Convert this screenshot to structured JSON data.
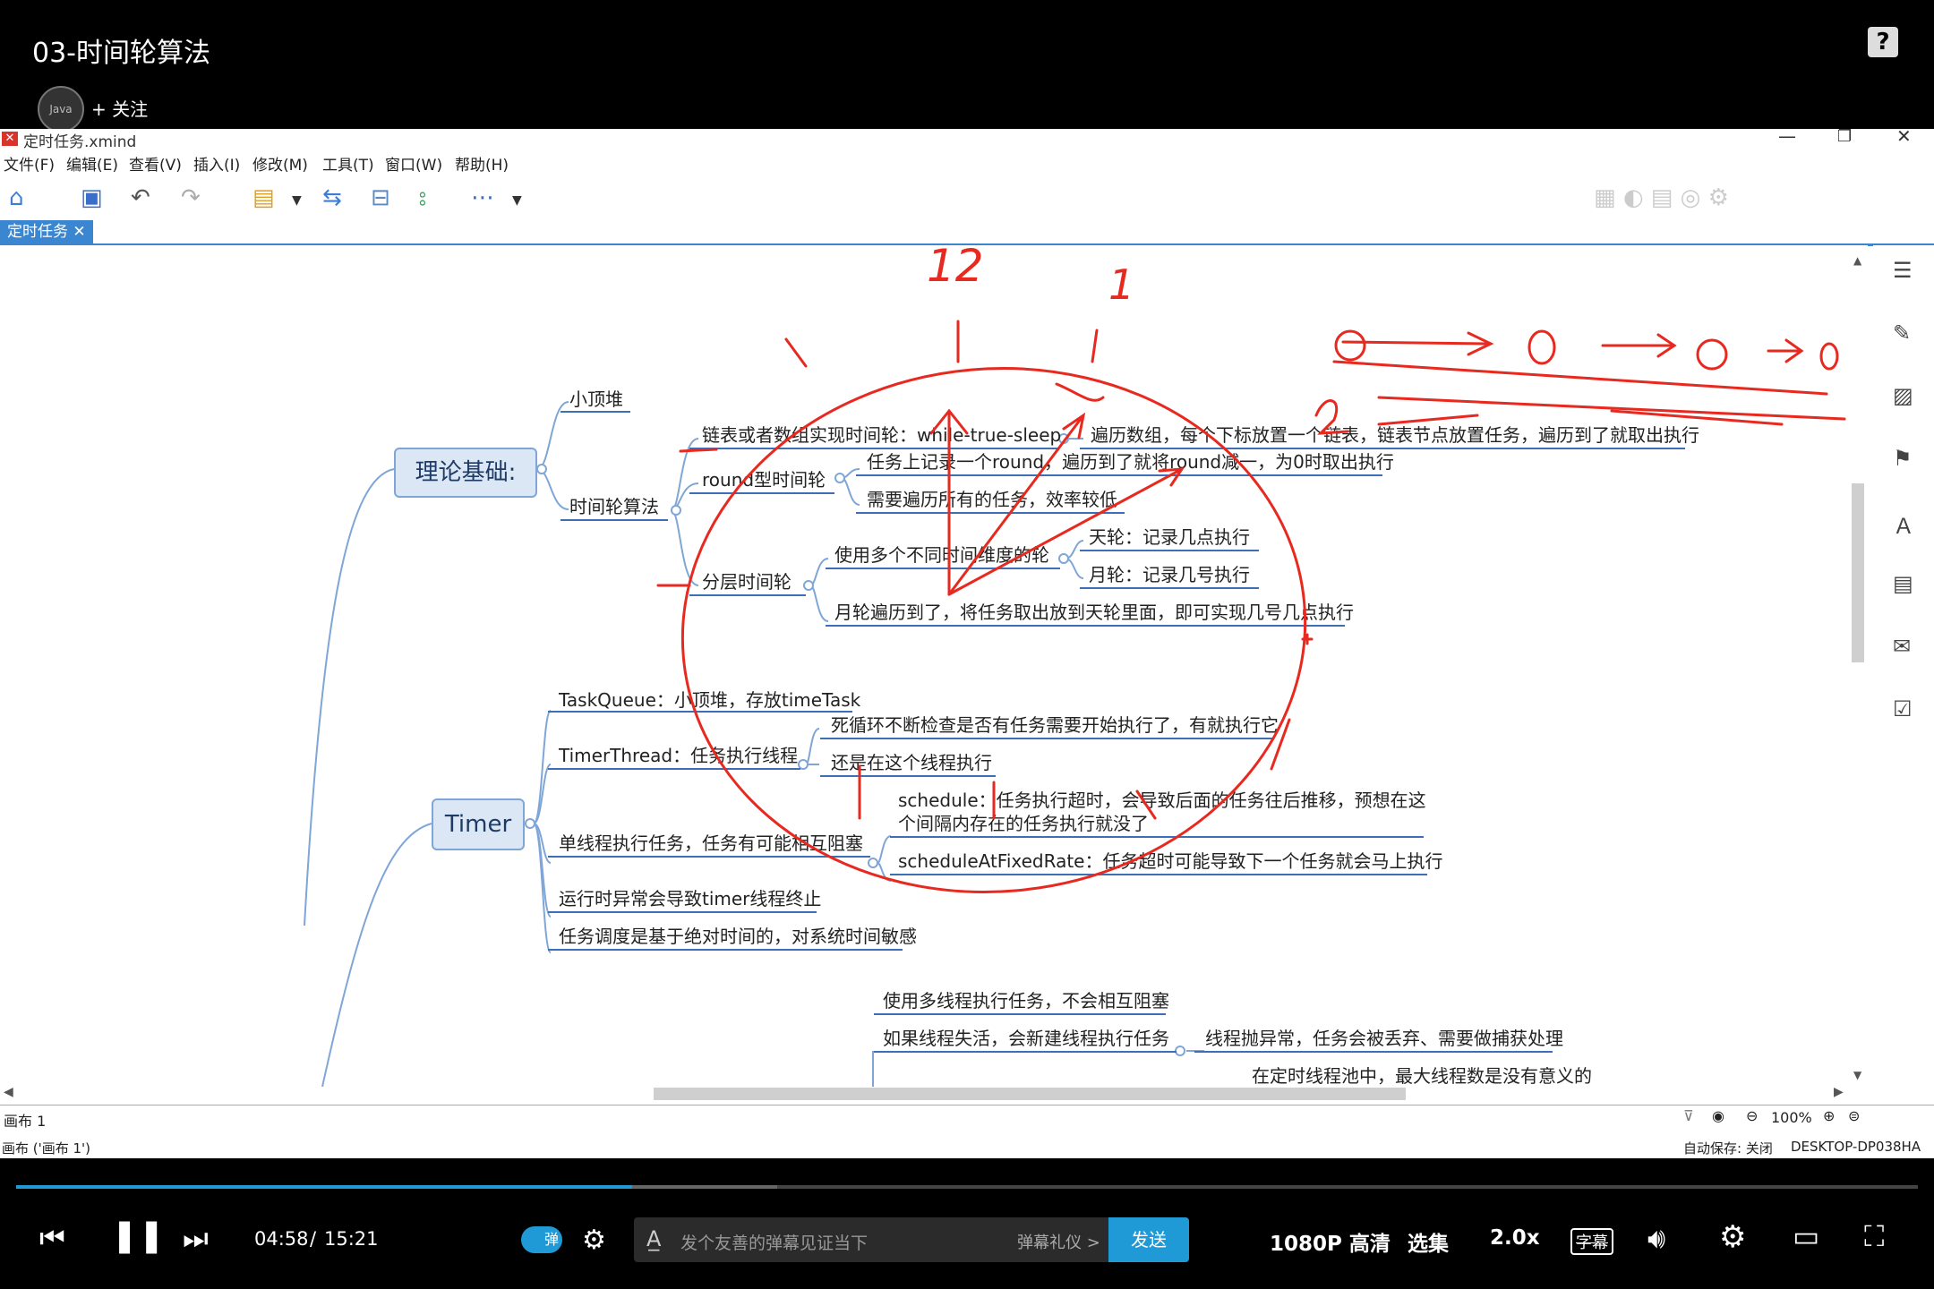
{
  "header": {
    "video_title": "03-时间轮算法",
    "help_icon": "?",
    "avatar_text": "Java",
    "follow_label": "+ 关注"
  },
  "app": {
    "file_title": "定时任务.xmind",
    "menu": [
      "文件(F)",
      "编辑(E)",
      "查看(V)",
      "插入(I)",
      "修改(M)",
      "工具(T)",
      "窗口(W)",
      "帮助(H)"
    ],
    "tab_label": "定时任务 ✕",
    "sheet_label": "画布 1",
    "zoom": "100%",
    "status_left": "画布 ('画布 1')",
    "autosave": "自动保存: 关闭",
    "machine": "DESKTOP-DP038HA"
  },
  "mindmap": {
    "topic_theory": "理论基础:",
    "topic_timer": "Timer",
    "heap": "小顶堆",
    "time_wheel_algo": "时间轮算法",
    "linked_wheel": "链表或者数组实现时间轮：while-true-sleep",
    "linked_wheel_desc": "遍历数组，每个下标放置一个链表，链表节点放置任务，遍历到了就取出执行",
    "round_wheel": "round型时间轮",
    "round_desc1": "任务上记录一个round，遍历到了就将round减一，为0时取出执行",
    "round_desc2": "需要遍历所有的任务，效率较低",
    "layered_wheel": "分层时间轮",
    "multi_dim": "使用多个不同时间维度的轮",
    "day_wheel": "天轮：记录几点执行",
    "month_wheel": "月轮：记录几号执行",
    "month_desc": "月轮遍历到了，将任务取出放到天轮里面，即可实现几号几点执行",
    "task_queue": "TaskQueue：小顶堆，存放timeTask",
    "timer_thread": "TimerThread：任务执行线程",
    "timer_thread_d1": "死循环不断检查是否有任务需要开始执行了，有就执行它",
    "timer_thread_d2": "还是在这个线程执行",
    "single_thread": "单线程执行任务，任务有可能相互阻塞",
    "schedule_l1": "schedule：任务执行超时，会导致后面的任务往后推移，预想在这",
    "schedule_l2": "个间隔内存在的任务执行就没了",
    "fixed_rate": "scheduleAtFixedRate：任务超时可能导致下一个任务就会马上执行",
    "runtime_ex": "运行时异常会导致timer线程终止",
    "absolute_time": "任务调度是基于绝对时间的，对系统时间敏感",
    "multi_thread": "使用多线程执行任务，不会相互阻塞",
    "thread_dead": "如果线程失活，会新建线程执行任务",
    "thread_ex": "线程抛异常，任务会被丢弃、需要做捕获处理",
    "pool_note": "在定时线程池中，最大线程数是没有意义的"
  },
  "annotations": {
    "twelve": "12",
    "one": "1",
    "zero": "0"
  },
  "player": {
    "time_current": "04:58",
    "time_sep": "/",
    "time_total": "15:21",
    "danmaku_toggle": "弹",
    "danmaku_placeholder": "发个友善的弹幕见证当下",
    "danmaku_etiquette": "弹幕礼仪 >",
    "send_label": "发送",
    "quality": "1080P 高清",
    "episodes": "选集",
    "speed": "2.0x",
    "subtitle": "字幕",
    "progress_fraction": 0.324
  },
  "colors": {
    "accent": "#1f9ad6",
    "annotation": "#e8291f",
    "topic_bg": "#dbe7f5",
    "branch_line": "#3d6fb6"
  }
}
